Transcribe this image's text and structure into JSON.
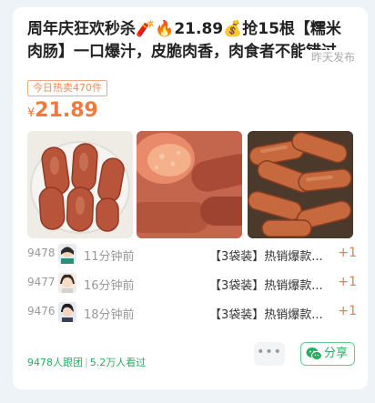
{
  "post": {
    "title": "周年庆狂欢秒杀🧨🔥21.89💰抢15根【糯米肉肠】一口爆汁，皮脆肉香，肉食者不能错过",
    "posted_label": "昨天发布",
    "hot_badge": "今日热卖470件",
    "price_symbol": "¥",
    "price_value": "21.89"
  },
  "followers": [
    {
      "count": "9478",
      "time": "11分钟前",
      "desc": "【3袋装】热销爆款...",
      "plus": "+1"
    },
    {
      "count": "9477",
      "time": "16分钟前",
      "desc": "【3袋装】热销爆款...",
      "plus": "+1"
    },
    {
      "count": "9476",
      "time": "18分钟前",
      "desc": "【3袋装】热销爆款...",
      "plus": "+1"
    }
  ],
  "stats": {
    "followed": "9478人跟团",
    "viewed": "5.2万人看过"
  },
  "actions": {
    "more_label": "•••",
    "share_label": "分享"
  },
  "colors": {
    "accent": "#f07a3d",
    "green": "#27ae60"
  }
}
